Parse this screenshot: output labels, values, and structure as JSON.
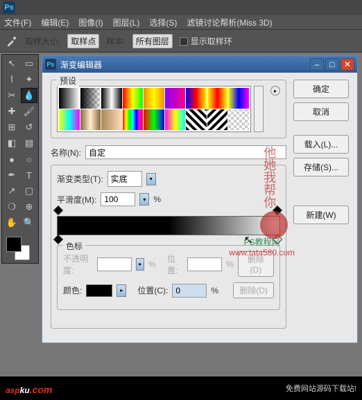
{
  "menubar": {
    "file": "文件(F)",
    "edit": "编辑(E)",
    "image": "图像(I)",
    "layer": "图层(L)",
    "select": "选择(S)",
    "extra": "滤镜讨论帮析(Miss 3D)"
  },
  "optbar": {
    "sampleSize": "取样大小:",
    "samplePoint": "取样点",
    "sampleLbl": "样本:",
    "allLayers": "所有图层",
    "showRing": "显示取样环"
  },
  "dialog": {
    "title": "渐变编辑器",
    "presets": "预设",
    "ok": "确定",
    "cancel": "取消",
    "load": "载入(L)...",
    "save": "存储(S)...",
    "new": "新建(W)",
    "nameLbl": "名称(N):",
    "nameVal": "自定",
    "typeLbl": "渐变类型(T):",
    "typeVal": "实底",
    "smoothLbl": "平滑度(M):",
    "smoothVal": "100",
    "pct": "%",
    "stops": "色标",
    "opacityLbl": "不透明度:",
    "posLbl": "位置:",
    "posLbl2": "位置(C):",
    "posVal": "0",
    "delete": "删除(D)",
    "colorLbl": "颜色:"
  },
  "watermark": {
    "txt": "他她我帮你",
    "site": "PS教程网",
    "url": "www.tata580.com"
  },
  "footer": {
    "brand_a": "asp",
    "brand_b": "ku",
    "brand_c": ".com",
    "txt": "免费网站源码下载站!"
  },
  "chart_data": null
}
